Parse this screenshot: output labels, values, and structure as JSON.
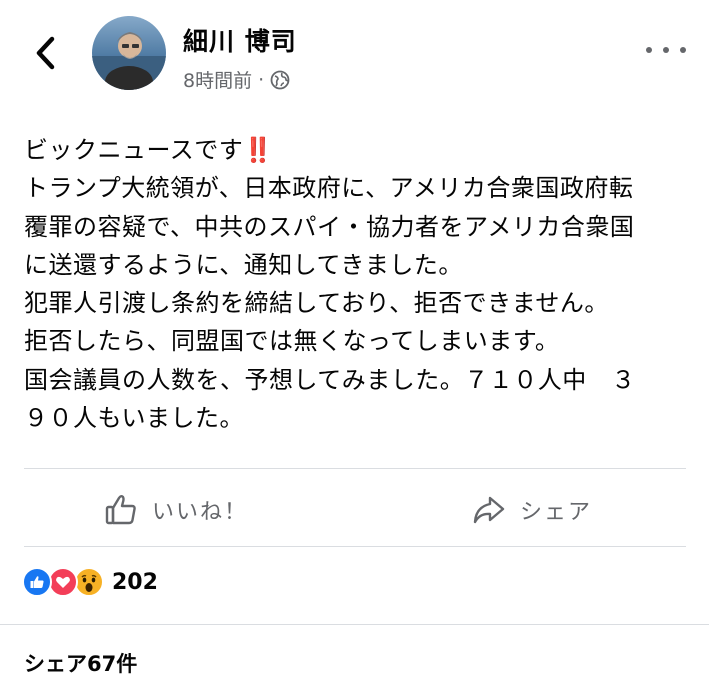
{
  "header": {
    "author": "細川 博司",
    "timestamp": "8時間前",
    "separator": "·",
    "icons": {
      "back": "chevron-left-icon",
      "audience": "globe-icon",
      "more": "more-horizontal-icon"
    }
  },
  "post": {
    "lines": [
      "ビックニュースです",
      "トランプ大統領が、日本政府に、アメリカ合衆国政府転",
      "覆罪の容疑で、中共のスパイ・協力者をアメリカ合衆国",
      "に送還するように、通知してきました。",
      "犯罪人引渡し条約を締結しており、拒否できません。",
      "拒否したら、同盟国では無くなってしまいます。",
      "国会議員の人数を、予想してみました。７１０人中　３",
      "９０人もいました。"
    ],
    "emoji": "‼️"
  },
  "actions": {
    "like_label": "いいね！",
    "share_label": "シェア"
  },
  "reactions": {
    "types": [
      "like",
      "love",
      "wow"
    ],
    "count": "202"
  },
  "shares": {
    "label": "シェア67件"
  },
  "colors": {
    "accent": "#1877f2",
    "love": "#f33e58",
    "wow": "#f7b125",
    "secondary_text": "#65676b"
  }
}
